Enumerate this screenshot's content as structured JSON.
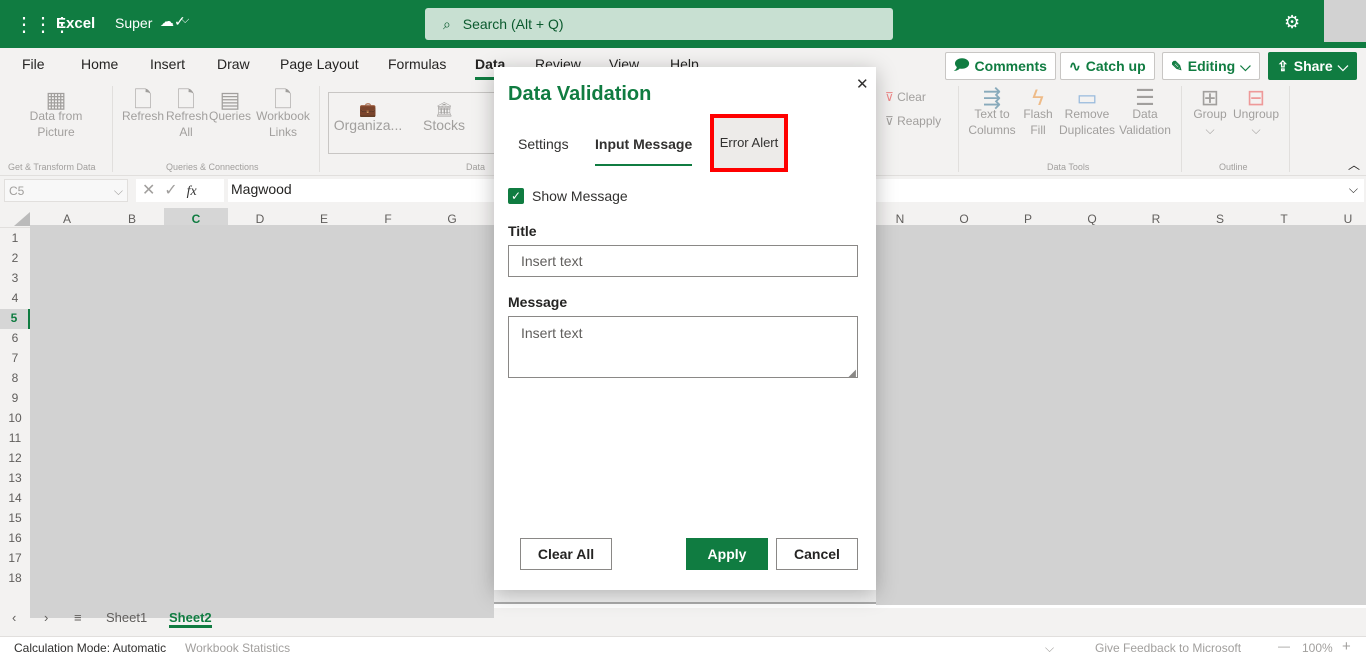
{
  "app": {
    "name": "Excel",
    "file": "Super",
    "search_placeholder": "Search (Alt + Q)"
  },
  "tabs": [
    "File",
    "Home",
    "Insert",
    "Draw",
    "Page Layout",
    "Formulas",
    "Data",
    "Review",
    "View",
    "Help"
  ],
  "active_tab": "Data",
  "actions": {
    "comments": "Comments",
    "catch_up": "Catch up",
    "editing": "Editing",
    "share": "Share"
  },
  "ribbon": {
    "data_from_picture": "Data from Picture",
    "refresh": "Refresh",
    "refresh_all": "Refresh All",
    "queries": "Queries",
    "workbook_links": "Workbook Links",
    "organiza": "Organiza...",
    "stocks": "Stocks",
    "clear": "Clear",
    "reapply": "Reapply",
    "text_to_columns": "Text to Columns",
    "flash_fill": "Flash Fill",
    "remove_duplicates": "Remove Duplicates",
    "data_validation": "Data Validation",
    "group": "Group",
    "ungroup": "Ungroup",
    "groups": {
      "get_transform": "Get & Transform Data",
      "queries_connections": "Queries & Connections",
      "data": "Data",
      "data_tools": "Data Tools",
      "outline": "Outline"
    }
  },
  "formula_bar": {
    "name_box": "C5",
    "fx": "fx",
    "value": "Magwood"
  },
  "columns_left": [
    "A",
    "B",
    "C",
    "D",
    "E",
    "F",
    "G"
  ],
  "columns_right": [
    "N",
    "O",
    "P",
    "Q",
    "R",
    "S",
    "T",
    "U"
  ],
  "rows": [
    "1",
    "2",
    "3",
    "4",
    "5",
    "6",
    "7",
    "8",
    "9",
    "10",
    "11",
    "12",
    "13",
    "14",
    "15",
    "16",
    "17",
    "18"
  ],
  "active_cell": {
    "column": "C",
    "row": "5"
  },
  "sheets": [
    "Sheet1",
    "Sheet2"
  ],
  "active_sheet": "Sheet2",
  "dialog": {
    "title": "Data Validation",
    "tabs": [
      "Settings",
      "Input Message",
      "Error Alert"
    ],
    "active_tab": "Input Message",
    "highlighted_tab": "Error Alert",
    "show_message_label": "Show Message",
    "show_message_checked": true,
    "title_label": "Title",
    "title_placeholder": "Insert text",
    "message_label": "Message",
    "message_placeholder": "Insert text",
    "clear_all": "Clear All",
    "apply": "Apply",
    "cancel": "Cancel"
  },
  "status": {
    "calc_mode": "Calculation Mode: Automatic",
    "workbook_stats": "Workbook Statistics",
    "feedback": "Give Feedback to Microsoft",
    "zoom": "100%"
  },
  "colors": {
    "brand": "#107c41",
    "highlight": "#ff0000"
  }
}
